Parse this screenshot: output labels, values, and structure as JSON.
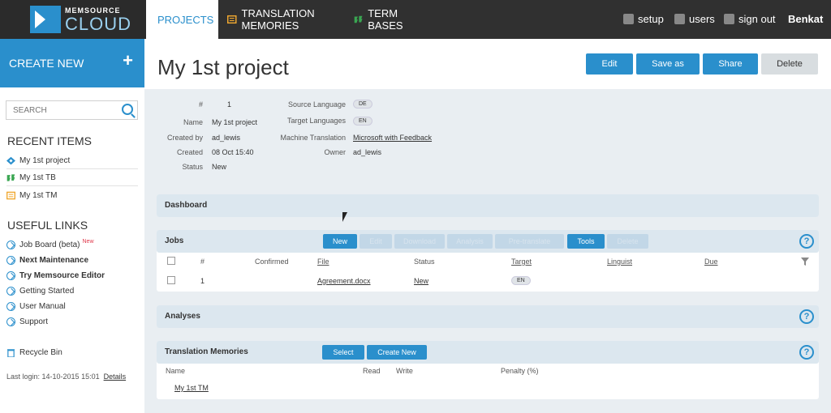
{
  "logo": {
    "small": "MEMSOURCE",
    "big": "CLOUD"
  },
  "nav": {
    "tabs": [
      {
        "label": "PROJECTS",
        "icon": "projects-icon"
      },
      {
        "label": "TRANSLATION MEMORIES",
        "icon": "translation-memory-icon"
      },
      {
        "label": "TERM BASES",
        "icon": "term-base-icon"
      }
    ],
    "setup": "setup",
    "users": "users",
    "signout": "sign out",
    "username": "Benkat"
  },
  "sidebar": {
    "create_new": "CREATE NEW",
    "search_placeholder": "SEARCH",
    "recent_heading": "RECENT ITEMS",
    "recent": [
      {
        "label": "My 1st project",
        "icon": "projects-icon"
      },
      {
        "label": "My 1st TB",
        "icon": "term-base-icon"
      },
      {
        "label": "My 1st TM",
        "icon": "translation-memory-icon"
      }
    ],
    "links_heading": "USEFUL LINKS",
    "links": [
      {
        "label": "Job Board (beta)",
        "badge": "New"
      },
      {
        "label": "Next Maintenance"
      },
      {
        "label": "Try Memsource Editor"
      },
      {
        "label": "Getting Started"
      },
      {
        "label": "User Manual"
      },
      {
        "label": "Support"
      }
    ],
    "recycle_bin": "Recycle Bin",
    "last_login": "Last login: 14-10-2015 15:01",
    "details": "Details"
  },
  "project": {
    "title": "My 1st project",
    "buttons": {
      "edit": "Edit",
      "save_as": "Save as",
      "share": "Share",
      "delete": "Delete"
    },
    "info": {
      "num_label": "#",
      "num_value": "1",
      "name_label": "Name",
      "name_value": "My 1st project",
      "created_by_label": "Created by",
      "created_by_value": "ad_lewis",
      "created_label": "Created",
      "created_value": "08 Oct 15:40",
      "status_label": "Status",
      "status_value": "New",
      "source_label": "Source Language",
      "source_value": "DE",
      "target_label": "Target Languages",
      "target_value": "EN",
      "mt_label": "Machine Translation",
      "mt_value": "Microsoft with Feedback",
      "owner_label": "Owner",
      "owner_value": "ad_lewis"
    }
  },
  "dashboard": {
    "title": "Dashboard"
  },
  "jobs": {
    "title": "Jobs",
    "buttons": [
      "New",
      "Edit",
      "Download",
      "Analysis",
      "Pre-translate",
      "Tools",
      "Delete"
    ],
    "columns": [
      "#",
      "Confirmed",
      "File",
      "Status",
      "Target",
      "Linguist",
      "Due"
    ],
    "rows": [
      {
        "num": "1",
        "file": "Agreement.docx",
        "status": "New",
        "target": "EN"
      }
    ]
  },
  "analyses": {
    "title": "Analyses"
  },
  "tm": {
    "title": "Translation Memories",
    "select": "Select",
    "create_new": "Create New",
    "columns": [
      "Name",
      "Read",
      "Write",
      "Penalty (%)"
    ],
    "rows": [
      {
        "name": "My 1st TM"
      }
    ]
  },
  "help": "?",
  "colors": {
    "accent": "#2a8fcc",
    "topbar": "#303030"
  }
}
